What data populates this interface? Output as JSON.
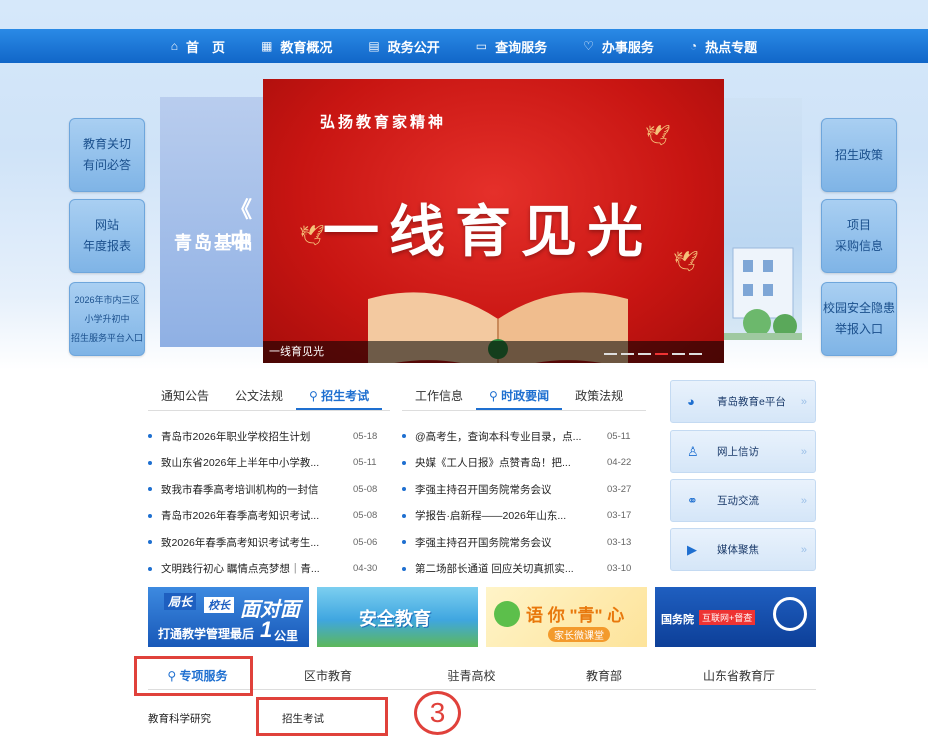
{
  "nav": [
    {
      "icon": "⌂",
      "icon_name": "home-icon",
      "label": "首　页"
    },
    {
      "icon": "▦",
      "icon_name": "grid-icon",
      "label": "教育概况"
    },
    {
      "icon": "▤",
      "icon_name": "document-icon",
      "label": "政务公开"
    },
    {
      "icon": "▭",
      "icon_name": "monitor-icon",
      "label": "查询服务"
    },
    {
      "icon": "♡",
      "icon_name": "heart-icon",
      "label": "办事服务"
    },
    {
      "icon": "◔",
      "icon_name": "hot-icon",
      "label": "热点专题"
    }
  ],
  "left_side": {
    "b1_l1": "教育关切",
    "b1_l2": "有问必答",
    "b2_l1": "网站",
    "b2_l2": "年度报表",
    "b3_l1": "2026年市内三区",
    "b3_l2": "小学升初中",
    "b3_l3": "招生服务平台入口"
  },
  "right_side": {
    "b1": "招生政策",
    "b2_l1": "项目",
    "b2_l2": "采购信息",
    "b3_l1": "校园安全隐患",
    "b3_l2": "举报入口"
  },
  "slides": {
    "left_quote": "《 中",
    "left_title": "青岛基础",
    "banner_sub": "弘扬教育家精神",
    "banner_main": "一线育见光",
    "banner_caption": "一线育见光"
  },
  "news_left": {
    "tabs": [
      "通知公告",
      "公文法规",
      "招生考试"
    ],
    "items": [
      {
        "title": "青岛市2026年职业学校招生计划",
        "date": "05-18"
      },
      {
        "title": "致山东省2026年上半年中小学教...",
        "date": "05-11"
      },
      {
        "title": "致我市春季高考培训机构的一封信",
        "date": "05-08"
      },
      {
        "title": "青岛市2026年春季高考知识考试...",
        "date": "05-08"
      },
      {
        "title": "致2026年春季高考知识考试考生...",
        "date": "05-06"
      },
      {
        "title": "文明践行初心 瞩情点亮梦想｜青...",
        "date": "04-30"
      }
    ]
  },
  "news_right": {
    "tabs": [
      "工作信息",
      "时政要闻",
      "政策法规"
    ],
    "items": [
      {
        "title": "@高考生，查询本科专业目录，点...",
        "date": "05-11"
      },
      {
        "title": "央媒《工人日报》点赞青岛！把...",
        "date": "04-22"
      },
      {
        "title": "李强主持召开国务院常务会议",
        "date": "03-27"
      },
      {
        "title": "学报告·启新程——2026年山东...",
        "date": "03-17"
      },
      {
        "title": "李强主持召开国务院常务会议",
        "date": "03-13"
      },
      {
        "title": "第二场部长通道 回应关切真抓实...",
        "date": "03-10"
      }
    ]
  },
  "right_buttons": [
    {
      "icon": "◕",
      "icon_name": "logo-icon",
      "label": "青岛教育e平台"
    },
    {
      "icon": "♙",
      "icon_name": "user-icon",
      "label": "网上信访"
    },
    {
      "icon": "⚭",
      "icon_name": "link-icon",
      "label": "互动交流"
    },
    {
      "icon": "▶",
      "icon_name": "video-icon",
      "label": "媒体聚焦"
    }
  ],
  "promos": {
    "p1_top1": "局长",
    "p1_top2": "校长",
    "p1_big": "面对面",
    "p1_bottom": "打通教学管理最后",
    "p1_num": "1",
    "p1_tail": "公里",
    "p2": "安全教育",
    "p3_main": "语 你 \"青\" 心",
    "p3_sub": "家长微课堂",
    "p4_a": "国务院",
    "p4_b": "互联网+督查"
  },
  "bottom_tabs": [
    "专项服务",
    "区市教育",
    "驻青高校",
    "教育部",
    "山东省教育厅"
  ],
  "sub_links": [
    "教育科学研究",
    "招生考试"
  ],
  "annotation": "3"
}
